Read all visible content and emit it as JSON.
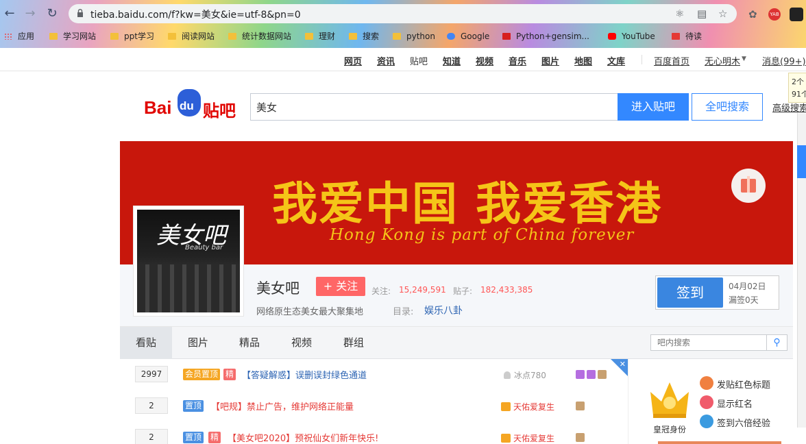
{
  "browser": {
    "url": "tieba.baidu.com/f?kw=美女&ie=utf-8&pn=0",
    "bookmarks": [
      {
        "label": "应用",
        "icon": "apps-grid-icon",
        "color": "#e44"
      },
      {
        "label": "学习网站",
        "icon": "folder-icon",
        "color": "#f3c03a"
      },
      {
        "label": "ppt学习",
        "icon": "folder-icon",
        "color": "#f3c03a"
      },
      {
        "label": "阅读网站",
        "icon": "folder-icon",
        "color": "#f3c03a"
      },
      {
        "label": "统计数据网站",
        "icon": "folder-icon",
        "color": "#f3c03a"
      },
      {
        "label": "理财",
        "icon": "folder-icon",
        "color": "#f3c03a"
      },
      {
        "label": "搜索",
        "icon": "folder-icon",
        "color": "#f3c03a"
      },
      {
        "label": "python",
        "icon": "folder-icon",
        "color": "#f3c03a"
      },
      {
        "label": "Google",
        "icon": "google-icon",
        "color": "#4285f4"
      },
      {
        "label": "Python+gensim...",
        "icon": "csdn-icon",
        "color": "#d71f1f"
      },
      {
        "label": "YouTube",
        "icon": "youtube-icon",
        "color": "#ff0000"
      },
      {
        "label": "待读",
        "icon": "q-icon",
        "color": "#e53935"
      }
    ]
  },
  "topnav": {
    "items": [
      "网页",
      "资讯",
      "贴吧",
      "知道",
      "视频",
      "音乐",
      "图片",
      "地图",
      "文库"
    ],
    "home": "百度首页",
    "user": "无心明木",
    "messages": "消息(99+)"
  },
  "tip": {
    "line1": "2个",
    "line2": "91个"
  },
  "search": {
    "logo_text": "Bai",
    "logo_du": "du",
    "logo_tieba": "贴吧",
    "query": "美女",
    "enter_label": "进入贴吧",
    "all_label": "全吧搜索",
    "advanced": "高级搜索"
  },
  "banner": {
    "title": "我爱中国  我爱香港",
    "subtitle": "Hong Kong is part of China forever"
  },
  "forum": {
    "avatar_title": "美女吧",
    "avatar_sub": "Beauty bar",
    "name": "美女吧",
    "follow_label": "+ 关注",
    "followers_label": "关注:",
    "followers": "15,249,591",
    "posts_label": "贴子:",
    "posts": "182,433,385",
    "description": "网络原生态美女最大聚集地",
    "dir_label": "目录:",
    "dir_value": "娱乐八卦",
    "sign_label": "签到",
    "sign_date": "04月02日",
    "sign_missed": "漏签0天"
  },
  "tabs": [
    "看贴",
    "图片",
    "精品",
    "视频",
    "群组"
  ],
  "inbar_search": {
    "placeholder": "吧内搜索"
  },
  "threads": [
    {
      "replies": "2997",
      "badges": [
        {
          "label": "会员置顶",
          "type": "member"
        },
        {
          "label": "精",
          "type": "jing"
        }
      ],
      "title": "【答疑解惑】误删误封绿色通道",
      "title_color": "#2d64b3",
      "author": "冰点780",
      "author_color": "#999"
    },
    {
      "replies": "2",
      "badges": [
        {
          "label": "置顶",
          "type": "top"
        }
      ],
      "title": "【吧规】禁止广告，维护网络正能量",
      "title_color": "#e53935",
      "author": "天佑爱复生",
      "author_color": "#e53935"
    },
    {
      "replies": "2",
      "badges": [
        {
          "label": "置顶",
          "type": "top"
        },
        {
          "label": "精",
          "type": "jing"
        }
      ],
      "title": "【美女吧2020】预祝仙女们新年快乐!",
      "title_color": "#e53935",
      "author": "天佑爱复生",
      "author_color": "#e53935"
    }
  ],
  "rpanel": {
    "crown_label": "皇冠身份",
    "perks": [
      {
        "label": "发贴红色标题",
        "color": "#f08040"
      },
      {
        "label": "显示红名",
        "color": "#f05b6b"
      },
      {
        "label": "签到六倍经验",
        "color": "#3b9be0"
      }
    ]
  }
}
